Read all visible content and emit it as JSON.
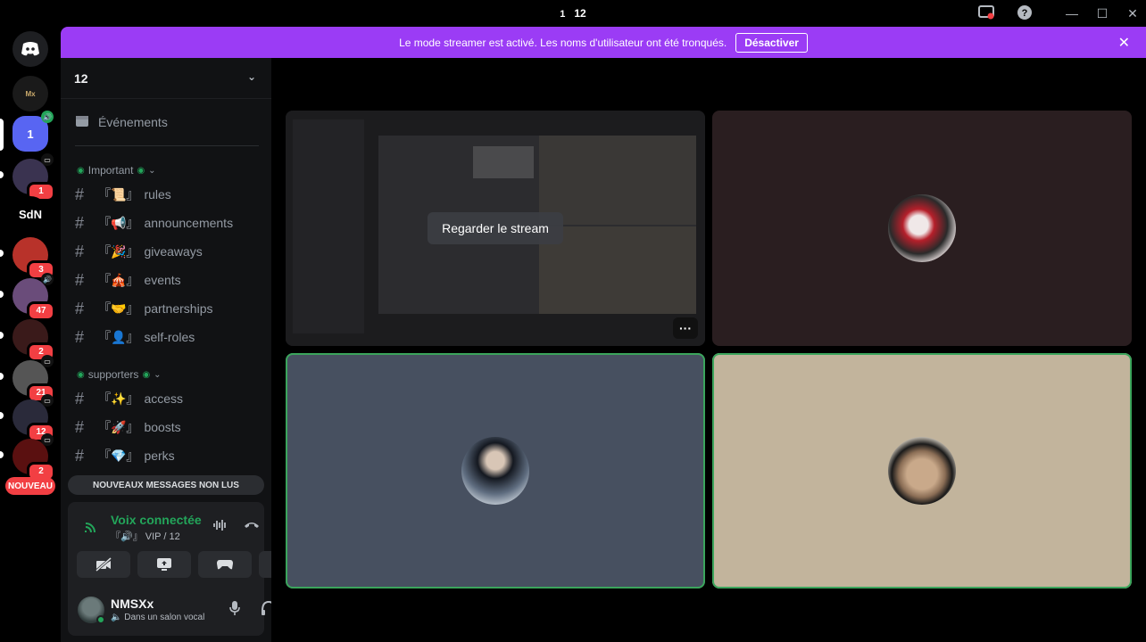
{
  "window": {
    "title_prefix": "1",
    "title": "12"
  },
  "banner": {
    "message": "Le mode streamer est activé. Les noms d'utilisateur ont été tronqués.",
    "button": "Désactiver"
  },
  "rail": {
    "servers": [
      {
        "label": "",
        "badge": ""
      },
      {
        "label": "1",
        "badge": ""
      },
      {
        "label": "",
        "badge": "1"
      },
      {
        "label": "SdN",
        "badge": ""
      },
      {
        "label": "",
        "badge": "3"
      },
      {
        "label": "",
        "badge": "47"
      },
      {
        "label": "",
        "badge": "2"
      },
      {
        "label": "",
        "badge": "21"
      },
      {
        "label": "",
        "badge": "12"
      },
      {
        "label": "",
        "badge": "2"
      }
    ],
    "new_label": "NOUVEAU"
  },
  "sidebar": {
    "server_name": "12",
    "events_label": "Événements",
    "categories": [
      {
        "name": "Important"
      },
      {
        "name": "supporters"
      }
    ],
    "channels": [
      {
        "emoji": "『📜』",
        "name": "rules"
      },
      {
        "emoji": "『📢』",
        "name": "announcements"
      },
      {
        "emoji": "『🎉』",
        "name": "giveaways"
      },
      {
        "emoji": "『🎪』",
        "name": "events"
      },
      {
        "emoji": "『🤝』",
        "name": "partnerships"
      },
      {
        "emoji": "『👤』",
        "name": "self-roles"
      },
      {
        "emoji": "『✨』",
        "name": "access"
      },
      {
        "emoji": "『🚀』",
        "name": "boosts"
      },
      {
        "emoji": "『💎』",
        "name": "perks"
      }
    ],
    "unread_label": "NOUVEAUX MESSAGES NON LUS"
  },
  "voice": {
    "status": "Voix connectée",
    "channel": "『🔊』 VIP / 12"
  },
  "user": {
    "name": "NMSXx",
    "status": "Dans un salon vocal"
  },
  "stage": {
    "watch_stream_label": "Regarder le stream",
    "more_label": "···"
  },
  "colors": {
    "accent": "#9b3cf5",
    "speaking": "#3ba55c",
    "danger": "#f23f43",
    "online": "#23a55a"
  }
}
